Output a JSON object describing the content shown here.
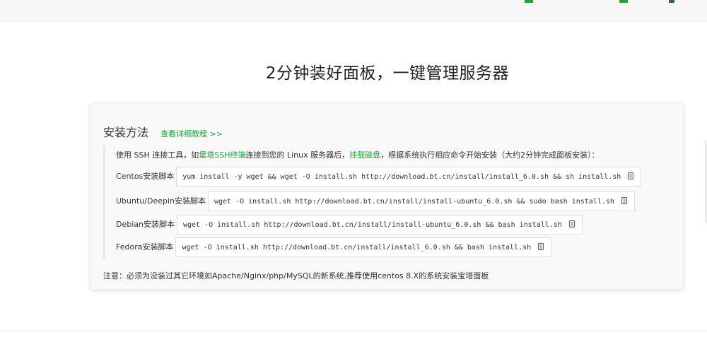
{
  "headline": "2分钟装好面板，一键管理服务器",
  "install": {
    "title": "安装方法",
    "detail_link": "查看详细教程 >>",
    "intro": {
      "part1": "使用 SSH 连接工具，如",
      "link1": "堡塔SSH终端",
      "part2": "连接到您的 Linux 服务器后，",
      "link2": "挂载磁盘",
      "part3": "，根据系统执行相应命令开始安装（大约2分钟完成面板安装）："
    },
    "rows": [
      {
        "label": "Centos安装脚本",
        "command": "yum install -y wget && wget -O install.sh http://download.bt.cn/install/install_6.0.sh && sh install.sh"
      },
      {
        "label": "Ubuntu/Deepin安装脚本",
        "command": "wget -O install.sh http://download.bt.cn/install/install-ubuntu_6.0.sh && sudo bash install.sh"
      },
      {
        "label": "Debian安装脚本",
        "command": "wget -O install.sh http://download.bt.cn/install/install-ubuntu_6.0.sh && bash install.sh"
      },
      {
        "label": "Fedora安装脚本",
        "command": "wget -O install.sh http://download.bt.cn/install/install_6.0.sh && bash install.sh"
      }
    ],
    "note": "注意：必须为没装过其它环境如Apache/Nginx/php/MySQL的新系统,推荐使用centos 8.X的系统安装宝塔面板",
    "copy_icon": "copy-icon"
  },
  "colors": {
    "accent": "#20a53a",
    "card_bg": "#f9f9f9",
    "text": "#333333"
  }
}
